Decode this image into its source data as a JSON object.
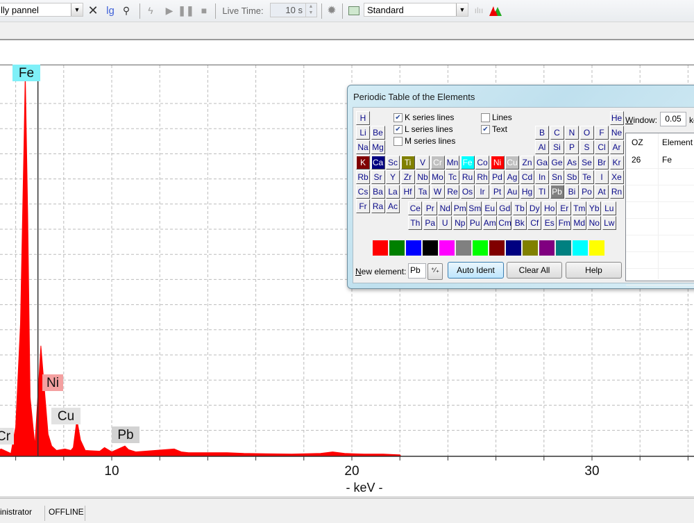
{
  "toolbar": {
    "profile_combo": "lly pannel",
    "clear_icon": "close-x-icon",
    "lg_label": "lg",
    "zoom_icon": "magnifier-icon",
    "live_time_label": "Live Time:",
    "live_time_value": "10 s",
    "settings_icon": "gear-icon",
    "mode_combo": "Standard"
  },
  "dialog": {
    "title": "Periodic Table of the Elements",
    "options": {
      "k_series": {
        "label": "K series lines",
        "checked": true
      },
      "l_series": {
        "label": "L series lines",
        "checked": true
      },
      "m_series": {
        "label": "M series lines",
        "checked": false
      },
      "lines": {
        "label": "Lines",
        "checked": false
      },
      "text": {
        "label": "Text",
        "checked": true
      }
    },
    "elements_main": [
      [
        "H",
        "",
        "",
        "",
        "",
        "",
        "",
        "",
        "",
        "",
        "",
        "",
        "",
        "",
        "",
        "",
        "",
        "He"
      ],
      [
        "Li",
        "Be",
        "",
        "",
        "",
        "",
        "",
        "",
        "",
        "",
        "",
        "",
        "B",
        "C",
        "N",
        "O",
        "F",
        "Ne"
      ],
      [
        "Na",
        "Mg",
        "",
        "",
        "",
        "",
        "",
        "",
        "",
        "",
        "",
        "",
        "Al",
        "Si",
        "P",
        "S",
        "Cl",
        "Ar"
      ],
      [
        "K",
        "Ca",
        "Sc",
        "Ti",
        "V",
        "Cr",
        "Mn",
        "Fe",
        "Co",
        "Ni",
        "Cu",
        "Zn",
        "Ga",
        "Ge",
        "As",
        "Se",
        "Br",
        "Kr"
      ],
      [
        "Rb",
        "Sr",
        "Y",
        "Zr",
        "Nb",
        "Mo",
        "Tc",
        "Ru",
        "Rh",
        "Pd",
        "Ag",
        "Cd",
        "In",
        "Sn",
        "Sb",
        "Te",
        "I",
        "Xe"
      ],
      [
        "Cs",
        "Ba",
        "La",
        "Hf",
        "Ta",
        "W",
        "Re",
        "Os",
        "Ir",
        "Pt",
        "Au",
        "Hg",
        "Tl",
        "Pb",
        "Bi",
        "Po",
        "At",
        "Rn"
      ],
      [
        "Fr",
        "Ra",
        "Ac"
      ]
    ],
    "lanthanides": [
      "Ce",
      "Pr",
      "Nd",
      "Pm",
      "Sm",
      "Eu",
      "Gd",
      "Tb",
      "Dy",
      "Ho",
      "Er",
      "Tm",
      "Yb",
      "Lu"
    ],
    "actinides": [
      "Th",
      "Pa",
      "U",
      "Np",
      "Pu",
      "Am",
      "Cm",
      "Bk",
      "Cf",
      "Es",
      "Fm",
      "Md",
      "No",
      "Lw"
    ],
    "highlighted": {
      "K": {
        "bg": "#800000",
        "fg": "#ffffff"
      },
      "Ca": {
        "bg": "#000080",
        "fg": "#ffffff"
      },
      "Ti": {
        "bg": "#808000",
        "fg": "#ffffff"
      },
      "Cr": {
        "bg": "#c0c0c0",
        "fg": "#ffffff"
      },
      "Fe": {
        "bg": "#00ffff",
        "fg": "#ffffff"
      },
      "Ni": {
        "bg": "#ff0000",
        "fg": "#ffffff"
      },
      "Cu": {
        "bg": "#c0c0c0",
        "fg": "#ffffff"
      },
      "Pb": {
        "bg": "#808080",
        "fg": "#ffffff"
      }
    },
    "palette": [
      "#ff0000",
      "#008000",
      "#0000ff",
      "#000000",
      "#ff00ff",
      "#808080",
      "#00ff00",
      "#800000",
      "#000080",
      "#808000",
      "#800080",
      "#008080",
      "#00ffff",
      "#ffff00"
    ],
    "new_element_label": "New element:",
    "new_element_value": "Pb",
    "auto_ident_label": "Auto Ident",
    "clear_all_label": "Clear All",
    "help_label": "Help",
    "window_label": "Window:",
    "window_value": "0.05",
    "window_unit": "ke",
    "table": {
      "columns": [
        "OZ",
        "Element"
      ],
      "rows": [
        [
          "26",
          "Fe"
        ]
      ]
    }
  },
  "status": {
    "user": "inistrator",
    "mode": "OFFLINE"
  },
  "chart_data": {
    "type": "area",
    "title": "",
    "xlabel": "- keV -",
    "ylabel": "",
    "xlim": [
      -4.6,
      34.2
    ],
    "x_ticks": [
      10,
      20,
      30
    ],
    "grid": true,
    "series": [
      {
        "name": "spectrum",
        "color": "#ff0000",
        "points": [
          [
            -4.6,
            2
          ],
          [
            -4,
            3
          ],
          [
            -3,
            2.5
          ],
          [
            -2,
            3
          ],
          [
            -1,
            3
          ],
          [
            0,
            3
          ],
          [
            0.5,
            4
          ],
          [
            1,
            3
          ],
          [
            1.5,
            7
          ],
          [
            1.8,
            4
          ],
          [
            2,
            4
          ],
          [
            2.3,
            5
          ],
          [
            2.6,
            3
          ],
          [
            3.3,
            4
          ],
          [
            3.7,
            6
          ],
          [
            4,
            4
          ],
          [
            4.5,
            5
          ],
          [
            5.0,
            5
          ],
          [
            5.4,
            10
          ],
          [
            5.8,
            4
          ],
          [
            6.0,
            40
          ],
          [
            6.2,
            180
          ],
          [
            6.35,
            430
          ],
          [
            6.4,
            520
          ],
          [
            6.5,
            330
          ],
          [
            6.6,
            80
          ],
          [
            6.8,
            15
          ],
          [
            7.05,
            150
          ],
          [
            7.2,
            90
          ],
          [
            7.35,
            30
          ],
          [
            7.5,
            14
          ],
          [
            7.7,
            8
          ],
          [
            8.05,
            10
          ],
          [
            8.3,
            8
          ],
          [
            8.4,
            12
          ],
          [
            8.55,
            50
          ],
          [
            8.7,
            22
          ],
          [
            8.9,
            8
          ],
          [
            9.5,
            7
          ],
          [
            9.7,
            12
          ],
          [
            10.0,
            6
          ],
          [
            10.55,
            14
          ],
          [
            10.7,
            9
          ],
          [
            11,
            6
          ],
          [
            12.6,
            10
          ],
          [
            12.9,
            6
          ],
          [
            13.2,
            5
          ],
          [
            14.8,
            5
          ],
          [
            15.5,
            4
          ],
          [
            17.5,
            3
          ],
          [
            18.7,
            4
          ],
          [
            19.2,
            6
          ],
          [
            19.7,
            4
          ],
          [
            20.5,
            3
          ],
          [
            21.3,
            3
          ],
          [
            22,
            2
          ],
          [
            22.05,
            0
          ]
        ]
      }
    ],
    "annotations": [
      {
        "label": "Fe",
        "x": 6.4,
        "bg": "#7ff0f8"
      },
      {
        "label": "Ni",
        "x": 7.48,
        "bg": "#f4a0a0"
      },
      {
        "label": "Cu",
        "x": 8.05,
        "bg": "#e2e2e2"
      },
      {
        "label": "Pb",
        "x": 10.55,
        "bg": "#d2d2d2"
      },
      {
        "label": "Cr",
        "x": 5.41,
        "bg": "#e2e2e2"
      }
    ],
    "cursor_x": 7.1
  }
}
